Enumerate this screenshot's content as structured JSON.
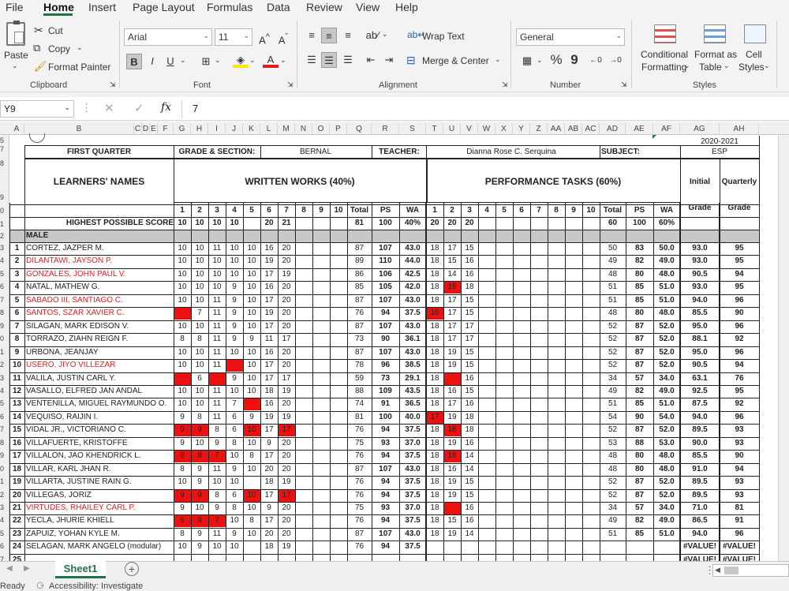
{
  "menu": {
    "items": [
      "File",
      "Home",
      "Insert",
      "Page Layout",
      "Formulas",
      "Data",
      "Review",
      "View",
      "Help"
    ],
    "active": "Home"
  },
  "ribbon": {
    "clipboard": {
      "paste": "Paste",
      "cut": "Cut",
      "copy": "Copy",
      "format_painter": "Format Painter",
      "label": "Clipboard"
    },
    "font": {
      "name": "Arial",
      "size": "11",
      "bold": "B",
      "italic": "I",
      "underline": "U",
      "label": "Font",
      "grow": "A^",
      "shrink": "Aˇ",
      "font_color_glyph": "A"
    },
    "alignment": {
      "wrap_text": "Wrap Text",
      "merge_center": "Merge & Center",
      "label": "Alignment"
    },
    "number": {
      "format": "General",
      "percent": "%",
      "comma": "9",
      "label": "Number"
    },
    "styles": {
      "conditional": "Conditional",
      "conditional2": "Formatting",
      "format_as": "Format as",
      "format_as2": "Table",
      "cell": "Cell",
      "cell2": "Styles",
      "label": "Styles"
    }
  },
  "formula_bar": {
    "name_box": "Y9",
    "fx": "fx",
    "value": "7"
  },
  "columns": [
    "A",
    "B",
    "C",
    "D",
    "E",
    "F",
    "G",
    "H",
    "I",
    "J",
    "K",
    "L",
    "M",
    "N",
    "O",
    "P",
    "Q",
    "R",
    "S",
    "T",
    "U",
    "V",
    "W",
    "X",
    "Y",
    "Z",
    "AA",
    "AB",
    "AC",
    "AD",
    "AE",
    "AF",
    "AG",
    "AH"
  ],
  "row_numbers": [
    "5",
    "7",
    "8",
    "9",
    "0",
    "1",
    "2",
    "3",
    "4",
    "5",
    "6",
    "7",
    "8",
    "9",
    "0",
    "1",
    "2",
    "3",
    "4",
    "5",
    "6",
    "7",
    "8",
    "9",
    "0",
    "1",
    "2",
    "3",
    "4",
    "5",
    "6",
    "7",
    "8",
    "9",
    "0",
    "1",
    "2",
    "3",
    "4",
    "5",
    "6",
    "7",
    "8"
  ],
  "sheet": {
    "school_year": "2020-2021",
    "quarter": "FIRST QUARTER",
    "grade_section_label": "GRADE & SECTION:",
    "grade_section": "BERNAL",
    "teacher_label": "TEACHER:",
    "teacher": "Dianna Rose C. Serquina",
    "subject_label": "SUBJECT:",
    "subject": "ESP",
    "learners_names": "LEARNERS' NAMES",
    "written_works": "WRITTEN WORKS (40%)",
    "performance_tasks": "PERFORMANCE TASKS (60%)",
    "initial": "Initial",
    "quarterly": "Quarterly",
    "grade": "Grade",
    "ww_cols": [
      "1",
      "2",
      "3",
      "4",
      "5",
      "6",
      "7",
      "8",
      "9",
      "10",
      "Total",
      "PS",
      "WA"
    ],
    "pt_cols": [
      "1",
      "2",
      "3",
      "4",
      "5",
      "6",
      "7",
      "8",
      "9",
      "10",
      "Total",
      "PS",
      "WA"
    ],
    "highest_label": "HIGHEST POSSIBLE SCORE",
    "highest_ww": [
      "10",
      "10",
      "10",
      "10",
      "",
      "20",
      "21",
      "",
      "",
      "",
      "81",
      "100",
      "40%"
    ],
    "highest_pt": [
      "20",
      "20",
      "20",
      "",
      "",
      "",
      "",
      "",
      "",
      "",
      "60",
      "100",
      "60%"
    ],
    "male_label": "MALE",
    "students": [
      {
        "n": "1",
        "name": "CORTEZ, JAZPER M.",
        "red": false,
        "ww": [
          "10",
          "10",
          "11",
          "10",
          "10",
          "16",
          "20"
        ],
        "wt": "87",
        "wps": "107",
        "wwa": "43.0",
        "pt": [
          "18",
          "17",
          "15"
        ],
        "pt_t": "50",
        "pps": "83",
        "pwa": "50.0",
        "ig": "93.0",
        "qg": "95"
      },
      {
        "n": "2",
        "name": "DILANTAWI, JAYSON P.",
        "red": true,
        "ww": [
          "10",
          "10",
          "10",
          "10",
          "10",
          "19",
          "20"
        ],
        "wt": "89",
        "wps": "110",
        "wwa": "44.0",
        "pt": [
          "18",
          "15",
          "16"
        ],
        "pt_t": "49",
        "pps": "82",
        "pwa": "49.0",
        "ig": "93.0",
        "qg": "95"
      },
      {
        "n": "3",
        "name": "GONZALES, JOHN PAUL V.",
        "red": true,
        "ww": [
          "10",
          "10",
          "10",
          "10",
          "10",
          "17",
          "19"
        ],
        "wt": "86",
        "wps": "106",
        "wwa": "42.5",
        "pt": [
          "18",
          "14",
          "16"
        ],
        "pt_t": "48",
        "pps": "80",
        "pwa": "48.0",
        "ig": "90.5",
        "qg": "94"
      },
      {
        "n": "4",
        "name": "NATAL, MATHEW G.",
        "red": false,
        "ww": [
          "10",
          "10",
          "10",
          "9",
          "10",
          "16",
          "20"
        ],
        "wt": "85",
        "wps": "105",
        "wwa": "42.0",
        "pt": [
          "18",
          "16",
          "18"
        ],
        "pt_t": "51",
        "pps": "85",
        "pwa": "51.0",
        "ig": "93.0",
        "qg": "95"
      },
      {
        "n": "5",
        "name": "SABADO III, SANTIAGO C.",
        "red": true,
        "ww": [
          "10",
          "10",
          "11",
          "9",
          "10",
          "17",
          "20"
        ],
        "wt": "87",
        "wps": "107",
        "wwa": "43.0",
        "pt": [
          "18",
          "17",
          "15"
        ],
        "pt_t": "51",
        "pps": "85",
        "pwa": "51.0",
        "ig": "94.0",
        "qg": "96"
      },
      {
        "n": "6",
        "name": "SANTOS, SZAR XAVIER C.",
        "red": true,
        "ww": [
          "",
          "7",
          "11",
          "9",
          "10",
          "19",
          "20"
        ],
        "wt": "76",
        "wps": "94",
        "wwa": "37.5",
        "pt": [
          "16",
          "17",
          "15"
        ],
        "pt_t": "48",
        "pps": "80",
        "pwa": "48.0",
        "ig": "85.5",
        "qg": "90"
      },
      {
        "n": "7",
        "name": "SILAGAN, MARK EDISON V.",
        "red": false,
        "ww": [
          "10",
          "10",
          "11",
          "9",
          "10",
          "17",
          "20"
        ],
        "wt": "87",
        "wps": "107",
        "wwa": "43.0",
        "pt": [
          "18",
          "17",
          "17"
        ],
        "pt_t": "52",
        "pps": "87",
        "pwa": "52.0",
        "ig": "95.0",
        "qg": "96"
      },
      {
        "n": "8",
        "name": "TORRAZO, ZIAHN REIGN F.",
        "red": false,
        "ww": [
          "8",
          "8",
          "11",
          "9",
          "9",
          "11",
          "17"
        ],
        "wt": "73",
        "wps": "90",
        "wwa": "36.1",
        "pt": [
          "18",
          "17",
          "17"
        ],
        "pt_t": "52",
        "pps": "87",
        "pwa": "52.0",
        "ig": "88.1",
        "qg": "92"
      },
      {
        "n": "9",
        "name": "URBONA, JEANJAY",
        "red": false,
        "ww": [
          "10",
          "10",
          "11",
          "10",
          "10",
          "16",
          "20"
        ],
        "wt": "87",
        "wps": "107",
        "wwa": "43.0",
        "pt": [
          "18",
          "19",
          "15"
        ],
        "pt_t": "52",
        "pps": "87",
        "pwa": "52.0",
        "ig": "95.0",
        "qg": "96"
      },
      {
        "n": "10",
        "name": "USERO, JIYO VILLEZAR",
        "red": true,
        "ww": [
          "10",
          "10",
          "11",
          "",
          "10",
          "17",
          "20"
        ],
        "wt": "78",
        "wps": "96",
        "wwa": "38.5",
        "pt": [
          "18",
          "19",
          "15"
        ],
        "pt_t": "52",
        "pps": "87",
        "pwa": "52.0",
        "ig": "90.5",
        "qg": "94"
      },
      {
        "n": "11",
        "name": "VALILA, JUSTIN CARL Y.",
        "red": false,
        "ww": [
          "",
          "6",
          "",
          "9",
          "10",
          "17",
          "17"
        ],
        "wt": "59",
        "wps": "73",
        "wwa": "29.1",
        "pt": [
          "18",
          "",
          "16"
        ],
        "pt_t": "34",
        "pps": "57",
        "pwa": "34.0",
        "ig": "63.1",
        "qg": "76"
      },
      {
        "n": "12",
        "name": "VASALLO, ELFRED JAN ANDAL",
        "red": false,
        "ww": [
          "10",
          "10",
          "11",
          "10",
          "10",
          "18",
          "19"
        ],
        "wt": "88",
        "wps": "109",
        "wwa": "43.5",
        "pt": [
          "18",
          "16",
          "15"
        ],
        "pt_t": "49",
        "pps": "82",
        "pwa": "49.0",
        "ig": "92.5",
        "qg": "95"
      },
      {
        "n": "13",
        "name": "VENTENILLA, MIGUEL RAYMUNDO O.",
        "red": false,
        "ww": [
          "10",
          "10",
          "11",
          "7",
          "",
          "16",
          "20"
        ],
        "wt": "74",
        "wps": "91",
        "wwa": "36.5",
        "pt": [
          "18",
          "17",
          "16"
        ],
        "pt_t": "51",
        "pps": "85",
        "pwa": "51.0",
        "ig": "87.5",
        "qg": "92"
      },
      {
        "n": "14",
        "name": "VEQUISO, RAIJIN I.",
        "red": false,
        "ww": [
          "9",
          "8",
          "11",
          "6",
          "9",
          "19",
          "19"
        ],
        "wt": "81",
        "wps": "100",
        "wwa": "40.0",
        "pt": [
          "17",
          "19",
          "18"
        ],
        "pt_t": "54",
        "pps": "90",
        "pwa": "54.0",
        "ig": "94.0",
        "qg": "96"
      },
      {
        "n": "15",
        "name": "VIDAL JR., VICTORIANO C.",
        "red": false,
        "ww": [
          "9",
          "9",
          "8",
          "6",
          "10",
          "17",
          "17"
        ],
        "wt": "76",
        "wps": "94",
        "wwa": "37.5",
        "pt": [
          "18",
          "16",
          "18"
        ],
        "pt_t": "52",
        "pps": "87",
        "pwa": "52.0",
        "ig": "89.5",
        "qg": "93"
      },
      {
        "n": "16",
        "name": "VILLAFUERTE, KRISTOFFE",
        "red": false,
        "ww": [
          "9",
          "10",
          "9",
          "8",
          "10",
          "9",
          "20"
        ],
        "wt": "75",
        "wps": "93",
        "wwa": "37.0",
        "pt": [
          "18",
          "19",
          "16"
        ],
        "pt_t": "53",
        "pps": "88",
        "pwa": "53.0",
        "ig": "90.0",
        "qg": "93"
      },
      {
        "n": "17",
        "name": "VILLALON, JAO KHENDRICK L.",
        "red": false,
        "ww": [
          "6",
          "8",
          "7",
          "10",
          "8",
          "17",
          "20"
        ],
        "wt": "76",
        "wps": "94",
        "wwa": "37.5",
        "pt": [
          "18",
          "16",
          "14"
        ],
        "pt_t": "48",
        "pps": "80",
        "pwa": "48.0",
        "ig": "85.5",
        "qg": "90"
      },
      {
        "n": "18",
        "name": "VILLAR, KARL JHAN R.",
        "red": false,
        "ww": [
          "8",
          "9",
          "11",
          "9",
          "10",
          "20",
          "20"
        ],
        "wt": "87",
        "wps": "107",
        "wwa": "43.0",
        "pt": [
          "18",
          "16",
          "14"
        ],
        "pt_t": "48",
        "pps": "80",
        "pwa": "48.0",
        "ig": "91.0",
        "qg": "94"
      },
      {
        "n": "19",
        "name": "VILLARTA, JUSTINE RAIN G.",
        "red": false,
        "ww": [
          "10",
          "9",
          "10",
          "10",
          "",
          "18",
          "19"
        ],
        "wt": "76",
        "wps": "94",
        "wwa": "37.5",
        "pt": [
          "18",
          "19",
          "15"
        ],
        "pt_t": "52",
        "pps": "87",
        "pwa": "52.0",
        "ig": "89.5",
        "qg": "93"
      },
      {
        "n": "20",
        "name": "VILLEGAS, JORIZ",
        "red": false,
        "ww": [
          "9",
          "9",
          "8",
          "6",
          "10",
          "17",
          "17"
        ],
        "wt": "76",
        "wps": "94",
        "wwa": "37.5",
        "pt": [
          "18",
          "19",
          "15"
        ],
        "pt_t": "52",
        "pps": "87",
        "pwa": "52.0",
        "ig": "89.5",
        "qg": "93"
      },
      {
        "n": "21",
        "name": "VIRTUDES, RHAILEY CARL P.",
        "red": true,
        "ww": [
          "9",
          "10",
          "9",
          "8",
          "10",
          "9",
          "20"
        ],
        "wt": "75",
        "wps": "93",
        "wwa": "37.0",
        "pt": [
          "18",
          "",
          "16"
        ],
        "pt_t": "34",
        "pps": "57",
        "pwa": "34.0",
        "ig": "71.0",
        "qg": "81"
      },
      {
        "n": "22",
        "name": "YECLA, JHURIE KHIELL",
        "red": false,
        "ww": [
          "6",
          "8",
          "7",
          "10",
          "8",
          "17",
          "20"
        ],
        "wt": "76",
        "wps": "94",
        "wwa": "37.5",
        "pt": [
          "18",
          "15",
          "16"
        ],
        "pt_t": "49",
        "pps": "82",
        "pwa": "49.0",
        "ig": "86.5",
        "qg": "91"
      },
      {
        "n": "23",
        "name": "ZAPUIZ, YOHAN KYLE M.",
        "red": false,
        "ww": [
          "8",
          "9",
          "11",
          "9",
          "10",
          "20",
          "20"
        ],
        "wt": "87",
        "wps": "107",
        "wwa": "43.0",
        "pt": [
          "18",
          "19",
          "14"
        ],
        "pt_t": "51",
        "pps": "85",
        "pwa": "51.0",
        "ig": "94.0",
        "qg": "96"
      },
      {
        "n": "24",
        "name": "SELAGAN, MARK ANGELO (modular)",
        "red": false,
        "ww": [
          "10",
          "9",
          "10",
          "10",
          "",
          "18",
          "19"
        ],
        "wt": "76",
        "wps": "94",
        "wwa": "37.5",
        "pt": [
          "",
          "",
          ""
        ],
        "pt_t": "",
        "pps": "",
        "pwa": "",
        "ig": "#VALUE!",
        "qg": "#VALUE!"
      },
      {
        "n": "25",
        "name": "",
        "red": false,
        "ww": [
          "",
          "",
          "",
          "",
          "",
          "",
          ""
        ],
        "wt": "",
        "wps": "",
        "wwa": "",
        "pt": [
          "",
          "",
          ""
        ],
        "pt_t": "",
        "pps": "",
        "pwa": "",
        "ig": "#VALUE!",
        "qg": "#VALUE!"
      }
    ],
    "red_ww": [
      [],
      [],
      [],
      [],
      [],
      [
        0
      ],
      [],
      [],
      [],
      [
        3
      ],
      [
        0,
        2
      ],
      [],
      [
        4
      ],
      [],
      [
        0,
        1,
        4,
        6
      ],
      [],
      [
        0,
        1,
        2
      ],
      [],
      [],
      [
        0,
        1,
        4,
        6
      ],
      [],
      [
        0,
        1,
        2
      ],
      [],
      [],
      []
    ],
    "red_pt": [
      [],
      [],
      [],
      [
        1
      ],
      [],
      [
        0
      ],
      [],
      [],
      [],
      [],
      [
        1
      ],
      [],
      [],
      [
        0
      ],
      [
        1
      ],
      [],
      [
        1
      ],
      [],
      [],
      [],
      [
        1
      ],
      [],
      [],
      [],
      []
    ]
  },
  "bottom": {
    "sheet_tab": "Sheet1",
    "add_sheet": "+"
  },
  "status": {
    "ready": "Ready",
    "accessibility": "Accessibility: Investigate"
  },
  "colors": {
    "accent": "#217346",
    "red_fill": "#ee1111",
    "red_text": "#e02020",
    "gray_fill": "#c8c8c8"
  }
}
